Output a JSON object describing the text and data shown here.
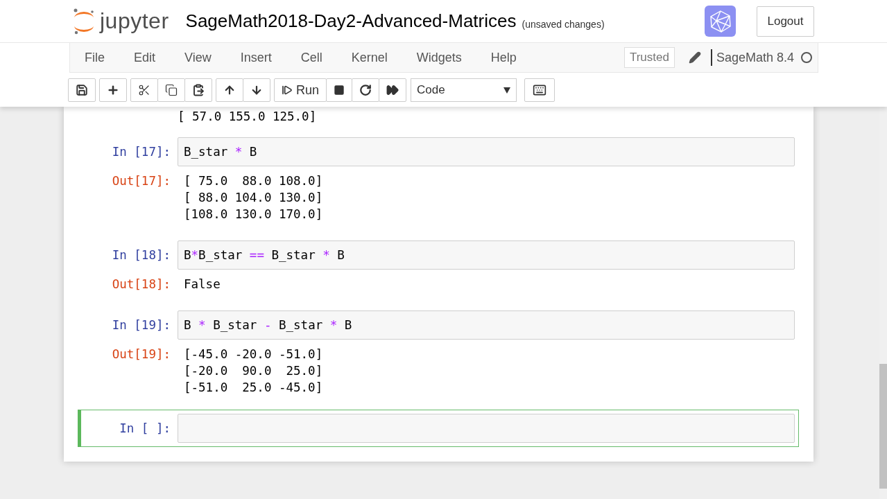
{
  "header": {
    "logo_text": "jupyter",
    "notebook_name": "SageMath2018-Day2-Advanced-Matrices",
    "save_status": "(unsaved changes)",
    "logout": "Logout"
  },
  "menu": [
    "File",
    "Edit",
    "View",
    "Insert",
    "Cell",
    "Kernel",
    "Widgets",
    "Help"
  ],
  "trusted": "Trusted",
  "kernel_name": "SageMath 8.4",
  "kernel_busy": false,
  "toolbar": {
    "run_label": "Run",
    "cell_type": "Code"
  },
  "cells": [
    {
      "kind": "output",
      "output": [
        "[ 57.0 155.0 125.0]"
      ]
    },
    {
      "kind": "code",
      "selected": false,
      "prompt_in": "In [17]:",
      "code": [
        {
          "kind": "name",
          "text": "B_star "
        },
        {
          "kind": "op",
          "text": "*"
        },
        {
          "kind": "name",
          "text": " B"
        }
      ],
      "prompt_out": "Out[17]:",
      "output": [
        "[ 75.0  88.0 108.0]",
        "[ 88.0 104.0 130.0]",
        "[108.0 130.0 170.0]"
      ]
    },
    {
      "kind": "code",
      "selected": false,
      "prompt_in": "In [18]:",
      "code": [
        {
          "kind": "name",
          "text": "B"
        },
        {
          "kind": "op",
          "text": "*"
        },
        {
          "kind": "name",
          "text": "B_star "
        },
        {
          "kind": "op",
          "text": "=="
        },
        {
          "kind": "name",
          "text": " B_star "
        },
        {
          "kind": "op",
          "text": "*"
        },
        {
          "kind": "name",
          "text": " B"
        }
      ],
      "prompt_out": "Out[18]:",
      "output": [
        "False"
      ]
    },
    {
      "kind": "code",
      "selected": false,
      "prompt_in": "In [19]:",
      "code": [
        {
          "kind": "name",
          "text": "B "
        },
        {
          "kind": "op",
          "text": "*"
        },
        {
          "kind": "name",
          "text": " B_star "
        },
        {
          "kind": "op",
          "text": "-"
        },
        {
          "kind": "name",
          "text": " B_star "
        },
        {
          "kind": "op",
          "text": "*"
        },
        {
          "kind": "name",
          "text": " B"
        }
      ],
      "prompt_out": "Out[19]:",
      "output": [
        "[-45.0 -20.0 -51.0]",
        "[-20.0  90.0  25.0]",
        "[-51.0  25.0 -45.0]"
      ]
    },
    {
      "kind": "code",
      "selected": true,
      "prompt_in": "In [ ]:"
    }
  ]
}
